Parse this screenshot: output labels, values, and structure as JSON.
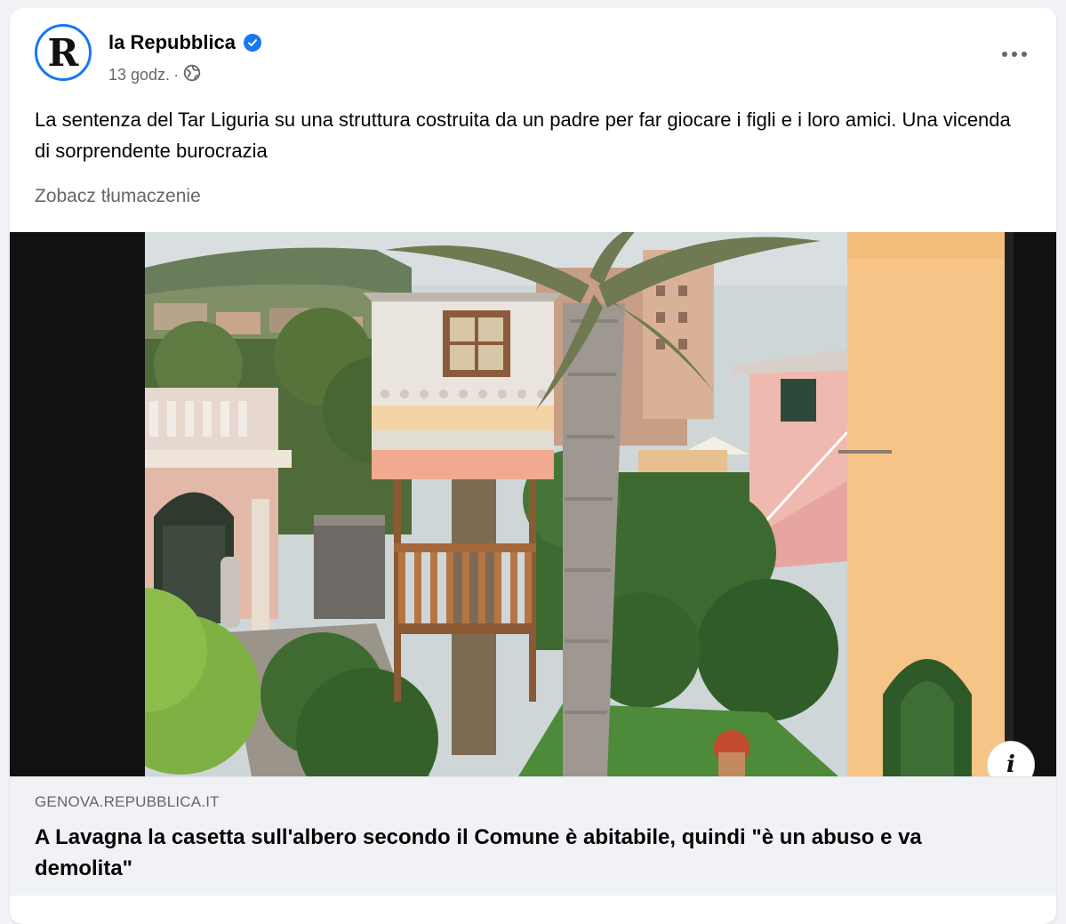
{
  "post": {
    "avatar_letter": "R",
    "page_name": "la Repubblica",
    "time": "13 godz.",
    "separator": "·",
    "audience_icon": "globe-icon",
    "more_icon": "more-options-icon",
    "text": "La sentenza del Tar Liguria su una struttura costruita da un padre per far giocare i figli e i loro amici. Una vicenda di sorprendente burocrazia",
    "see_translation": "Zobacz tłumaczenie"
  },
  "link_preview": {
    "domain": "GENOVA.REPUBBLICA.IT",
    "title": "A Lavagna la casetta sull'albero secondo il Comune è abitabile, quindi \"è un abuso e va demolita\"",
    "info_label": "i"
  },
  "colors": {
    "verified_blue": "#1877f2",
    "secondary_text": "#65676b",
    "footer_bg": "#f0f2f5"
  }
}
